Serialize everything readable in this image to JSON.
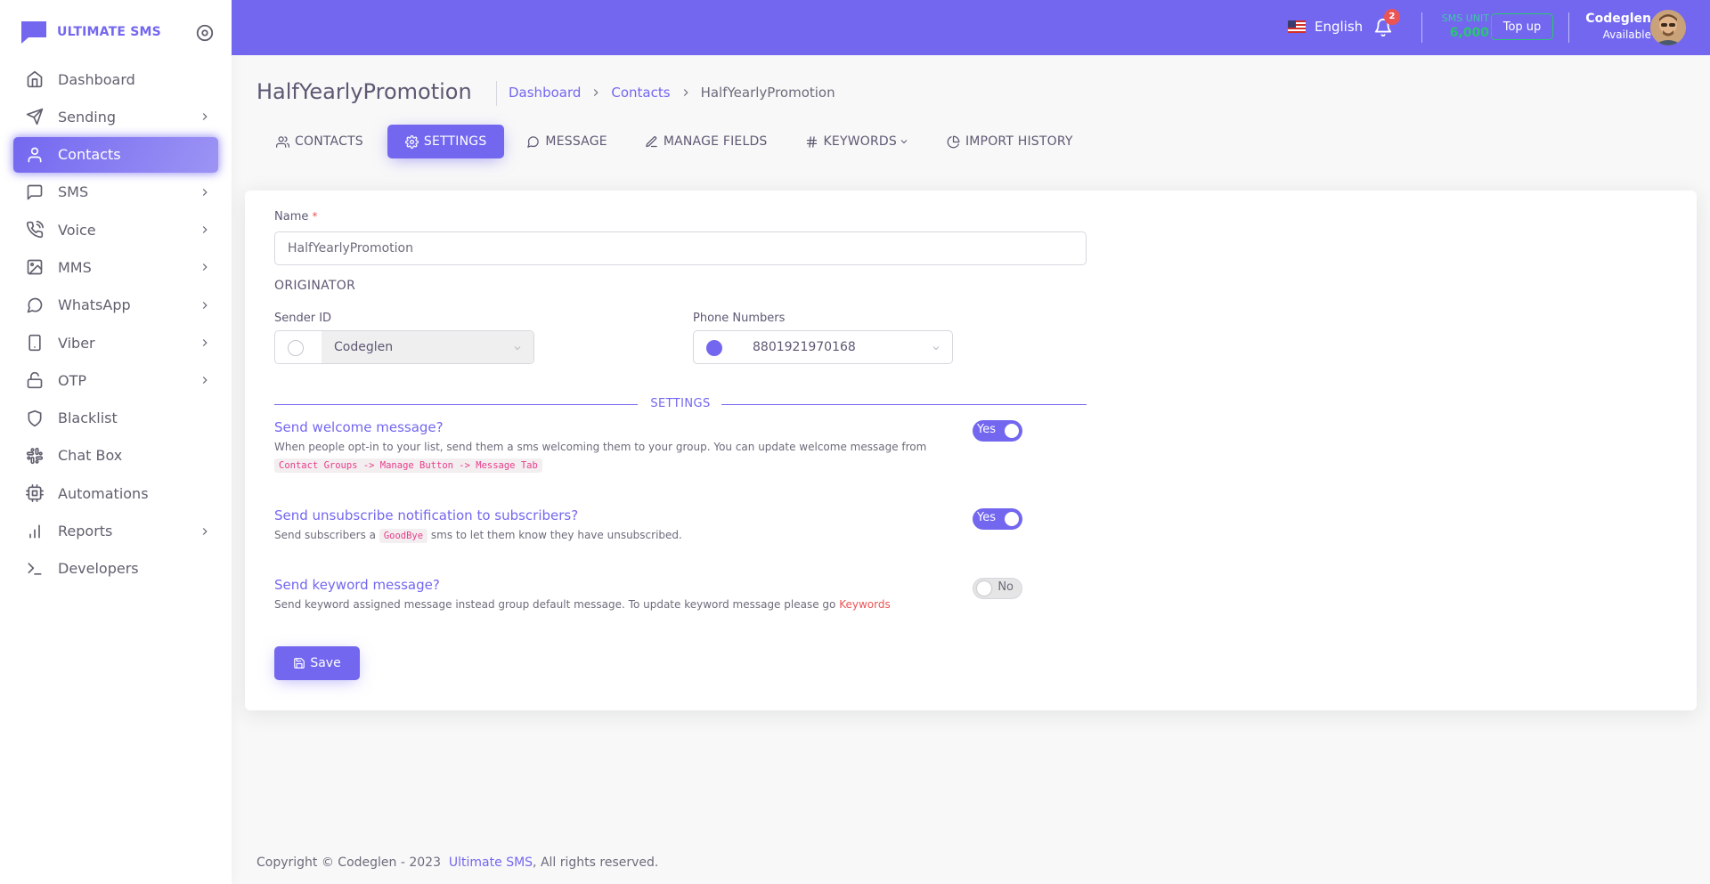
{
  "brand": {
    "name": "ULTIMATE SMS"
  },
  "sidebar": {
    "items": [
      {
        "label": "Dashboard",
        "icon": "home-icon",
        "has_children": false
      },
      {
        "label": "Sending",
        "icon": "send-icon",
        "has_children": true
      },
      {
        "label": "Contacts",
        "icon": "user-icon",
        "has_children": false,
        "active": true
      },
      {
        "label": "SMS",
        "icon": "message-square-icon",
        "has_children": true
      },
      {
        "label": "Voice",
        "icon": "phone-call-icon",
        "has_children": true
      },
      {
        "label": "MMS",
        "icon": "image-icon",
        "has_children": true
      },
      {
        "label": "WhatsApp",
        "icon": "message-circle-icon",
        "has_children": true
      },
      {
        "label": "Viber",
        "icon": "tablet-icon",
        "has_children": true
      },
      {
        "label": "OTP",
        "icon": "unlock-icon",
        "has_children": true
      },
      {
        "label": "Blacklist",
        "icon": "shield-icon",
        "has_children": false
      },
      {
        "label": "Chat Box",
        "icon": "slack-icon",
        "has_children": false
      },
      {
        "label": "Automations",
        "icon": "cpu-icon",
        "has_children": false
      },
      {
        "label": "Reports",
        "icon": "bar-chart-icon",
        "has_children": true
      },
      {
        "label": "Developers",
        "icon": "terminal-icon",
        "has_children": false
      }
    ]
  },
  "topbar": {
    "language": "English",
    "notification_count": "2",
    "units_label": "SMS UNIT",
    "units_value": "6,000",
    "topup_label": "Top up",
    "user_name": "Codeglen",
    "user_status": "Available"
  },
  "header": {
    "title": "HalfYearlyPromotion",
    "breadcrumb": [
      "Dashboard",
      "Contacts",
      "HalfYearlyPromotion"
    ]
  },
  "tabs": [
    {
      "label": "CONTACTS",
      "icon": "users-icon"
    },
    {
      "label": "SETTINGS",
      "icon": "settings-icon",
      "active": true
    },
    {
      "label": "MESSAGE",
      "icon": "message-circle-icon"
    },
    {
      "label": "MANAGE FIELDS",
      "icon": "edit-icon"
    },
    {
      "label": "KEYWORDS",
      "icon": "hash-icon",
      "dropdown": true
    },
    {
      "label": "IMPORT HISTORY",
      "icon": "pie-chart-icon"
    }
  ],
  "form": {
    "name_label": "Name",
    "name_required": "*",
    "name_value": "HalfYearlyPromotion",
    "originator_title": "ORIGINATOR",
    "sender_id_label": "Sender ID",
    "sender_id_value": "Codeglen",
    "phone_numbers_label": "Phone Numbers",
    "phone_numbers_value": "8801921970168",
    "settings_divider": "SETTINGS",
    "options": [
      {
        "title": "Send welcome message?",
        "desc": "When people opt-in to your list, send them a sms welcoming them to your group. You can update welcome message from",
        "tag": "Contact Groups -> Manage Button -> Message Tab",
        "toggle": "Yes",
        "on": true
      },
      {
        "title": "Send unsubscribe notification to subscribers?",
        "desc_before": "Send subscribers a",
        "tag": "GoodBye",
        "desc_after": "sms to let them know they have unsubscribed.",
        "toggle": "Yes",
        "on": true
      },
      {
        "title": "Send keyword message?",
        "desc": "Send keyword assigned message instead group default message. To update keyword message please go",
        "link": "Keywords",
        "toggle": "No",
        "on": false
      }
    ],
    "save_label": "Save"
  },
  "footer": {
    "text_before": "Copyright © Codeglen - 2023",
    "link": "Ultimate SMS",
    "text_after": ", All rights reserved."
  },
  "colors": {
    "primary": "#7367f0",
    "success": "#28c76f",
    "danger": "#ea5455"
  }
}
